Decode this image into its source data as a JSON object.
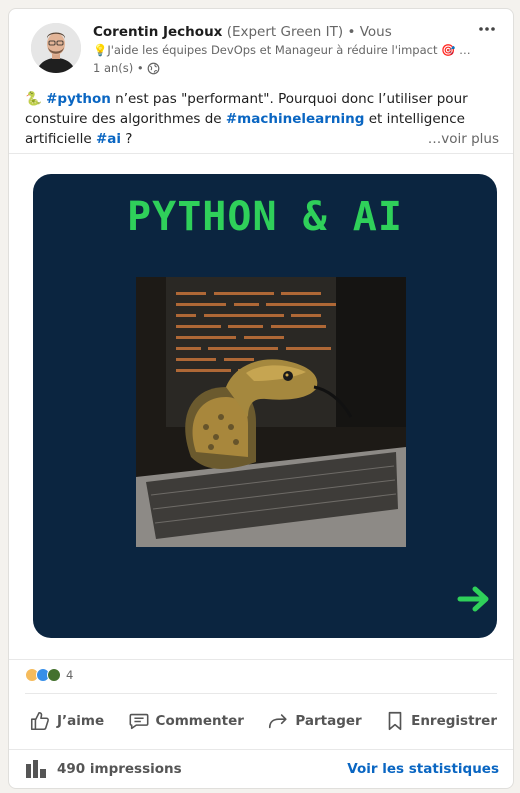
{
  "post": {
    "author_name": "Corentin Jechoux",
    "author_role": "(Expert Green IT)",
    "connection": "• Vous",
    "headline_icon": "💡",
    "headline": "J'aide les équipes DevOps et Manageur à réduire l'impact 🎯 d…",
    "time": "1 an(s) •",
    "visibility_icon": "globe-icon",
    "more_icon": "ellipsis-icon"
  },
  "body": {
    "emoji": "🐍",
    "tag_python": "#python",
    "t1": " n’est pas \"performant\". Pourquoi donc l’utiliser pour constuire des algorithmes de ",
    "tag_ml": "#machinelearning",
    "t2": " et intelligence artificielle ",
    "tag_ai": "#ai",
    "t3": " ?",
    "see_more": "…voir plus"
  },
  "slide": {
    "title": "PYTHON & AI",
    "background": "#0b2540",
    "accent": "#2fd05a",
    "arrow_icon": "arrow-right-icon"
  },
  "social": {
    "reaction_icons": [
      "insightful-icon",
      "like-icon",
      "support-icon"
    ],
    "reaction_count": "4"
  },
  "actions": {
    "like": "J’aime",
    "comment": "Commenter",
    "share": "Partager",
    "save": "Enregistrer"
  },
  "footer": {
    "impressions": "490 impressions",
    "stats_link": "Voir les statistiques"
  },
  "colors": {
    "link": "#0a66c2",
    "text": "#1d1d1d",
    "muted": "#666666"
  }
}
